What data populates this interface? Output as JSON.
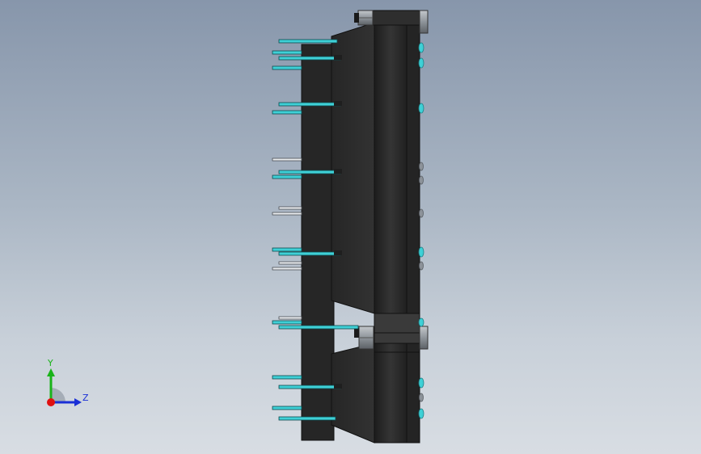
{
  "triad": {
    "y_label": "Y",
    "z_label": "Z",
    "colors": {
      "y": "#19b319",
      "z": "#1a2fd6",
      "x": "#e01010",
      "ring": "#9aa2ad"
    }
  },
  "model_colors": {
    "body": "#2b2b2b",
    "body_dark": "#1a1a1a",
    "body_light": "#3d3d3d",
    "pin": "#3fd0d6",
    "pin_grey": "#c9ced4",
    "nut": "#9aa0a6"
  }
}
